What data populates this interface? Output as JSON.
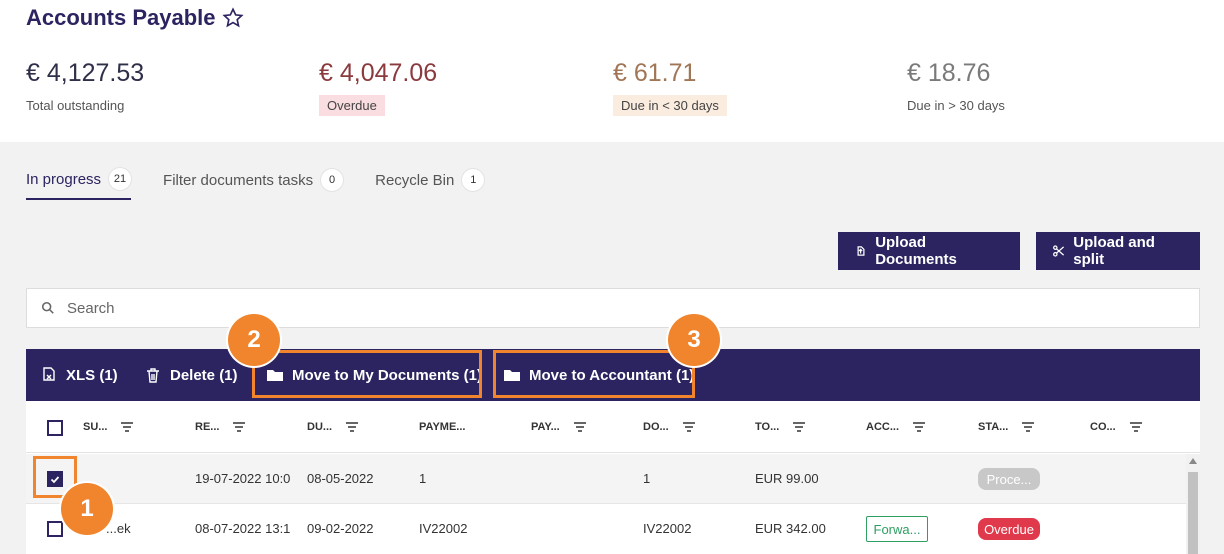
{
  "page": {
    "title": "Accounts Payable"
  },
  "stats": [
    {
      "amount": "€ 4,127.53",
      "label": "Total outstanding",
      "color": "#2f2f4a"
    },
    {
      "amount": "€ 4,047.06",
      "label": "Overdue",
      "color": "#8b3a3e",
      "badge_bg": "#f9dde1"
    },
    {
      "amount": "€ 61.71",
      "label": "Due in < 30 days",
      "color": "#a07657",
      "badge_bg": "#fbece0"
    },
    {
      "amount": "€ 18.76",
      "label": "Due in > 30 days",
      "color": "#7a7a7a"
    }
  ],
  "tabs": [
    {
      "label": "In progress",
      "count": "21"
    },
    {
      "label": "Filter documents tasks",
      "count": "0"
    },
    {
      "label": "Recycle Bin",
      "count": "1"
    }
  ],
  "actions": {
    "upload_documents": "Upload Documents",
    "upload_split": "Upload and split"
  },
  "search": {
    "placeholder": "Search"
  },
  "bulk_actions": {
    "xls": "XLS (1)",
    "delete": "Delete (1)",
    "move_my_documents": "Move to My Documents (1)",
    "move_accountant": "Move to Accountant (1)"
  },
  "table": {
    "columns": [
      "SU...",
      "RE...",
      "DU...",
      "PAYME...",
      "PAY...",
      "DO...",
      "TO...",
      "ACC...",
      "STA...",
      "CO..."
    ],
    "rows": [
      {
        "supplier": "",
        "received": "19-07-2022 10:0",
        "due": "08-05-2022",
        "payment_ref": "1",
        "document": "1",
        "total": "EUR 99.00",
        "account": "",
        "status": "Proce...",
        "checked": true
      },
      {
        "supplier": "...ek",
        "received": "08-07-2022 13:1",
        "due": "09-02-2022",
        "payment_ref": "IV22002",
        "document": "IV22002",
        "total": "EUR 342.00",
        "account": "Forwa...",
        "status": "Overdue",
        "checked": false
      }
    ]
  },
  "markers": [
    "1",
    "2",
    "3"
  ],
  "colors": {
    "brand": "#2b2460",
    "highlight": "#f0852d",
    "overdue": "#e0394b",
    "forward": "#2e9e62"
  }
}
